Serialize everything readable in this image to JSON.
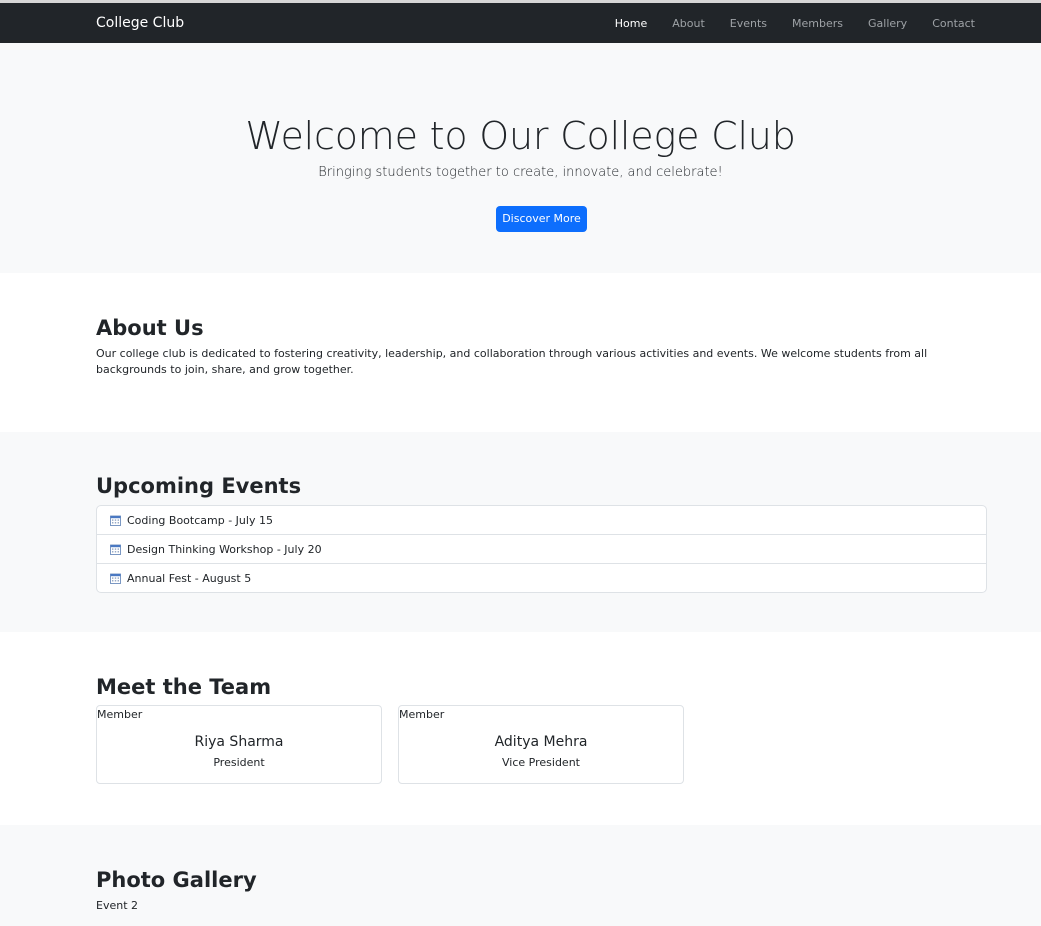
{
  "navbar": {
    "brand": "College Club",
    "links": [
      {
        "label": "Home",
        "active": true
      },
      {
        "label": "About"
      },
      {
        "label": "Events"
      },
      {
        "label": "Members"
      },
      {
        "label": "Gallery"
      },
      {
        "label": "Contact"
      }
    ]
  },
  "hero": {
    "title": "Welcome to Our College Club",
    "subtitle": "Bringing students together to create, innovate, and celebrate!",
    "button": "Discover More"
  },
  "about": {
    "title": "About Us",
    "text": "Our college club is dedicated to fostering creativity, leadership, and collaboration through various activities and events. We welcome students from all backgrounds to join, share, and grow together."
  },
  "events": {
    "title": "Upcoming Events",
    "items": [
      {
        "label": "Coding Bootcamp - July 15",
        "icon": "calendar-icon"
      },
      {
        "label": "Design Thinking Workshop - July 20",
        "icon": "calendar-icon"
      },
      {
        "label": "Annual Fest - August 5",
        "icon": "calendar-icon"
      }
    ]
  },
  "team": {
    "title": "Meet the Team",
    "members": [
      {
        "img_alt": "Member",
        "name": "Riya Sharma",
        "role": "President"
      },
      {
        "img_alt": "Member",
        "name": "Aditya Mehra",
        "role": "Vice President"
      }
    ]
  },
  "gallery": {
    "title": "Photo Gallery",
    "images": [
      {
        "alt": "Event 2"
      }
    ]
  },
  "colors": {
    "navbar_bg": "#212529",
    "primary": "#0d6efd",
    "section_alt_bg": "#f8f9fa"
  }
}
